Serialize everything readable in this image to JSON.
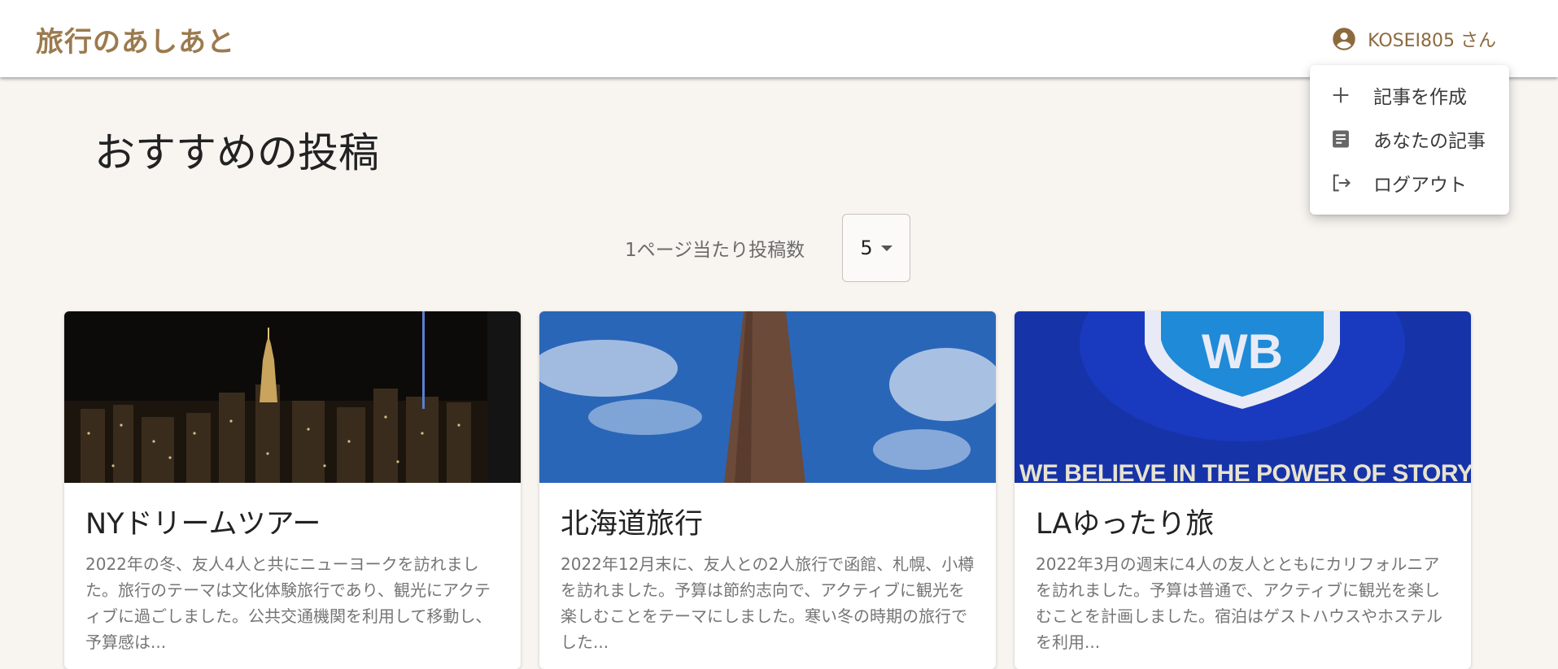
{
  "header": {
    "brand": "旅行のあしあと",
    "user_label": "KOSEI805 さん",
    "user_icon": "account-circle-icon"
  },
  "user_menu": {
    "items": [
      {
        "label": "記事を作成",
        "icon": "plus-icon"
      },
      {
        "label": "あなたの記事",
        "icon": "article-icon"
      },
      {
        "label": "ログアウト",
        "icon": "logout-icon"
      }
    ]
  },
  "main": {
    "title": "おすすめの投稿",
    "per_page_label": "1ページ当たり投稿数",
    "per_page_value": "5"
  },
  "posts": [
    {
      "title": "NYドリームツアー",
      "description": "2022年の冬、友人4人と共にニューヨークを訪れました。旅行のテーマは文化体験旅行であり、観光にアクティブに過ごしました。公共交通機関を利用して移動し、予算感は...",
      "image": "new-york-night-skyline-photo"
    },
    {
      "title": "北海道旅行",
      "description": "2022年12月末に、友人との2人旅行で函館、札幌、小樽を訪れました。予算は節約志向で、アクティブに観光を楽しむことをテーマにしました。寒い冬の時期の旅行でした...",
      "image": "brick-chimney-blue-sky-photo"
    },
    {
      "title": "LAゆったり旅",
      "description": "2022年3月の週末に4人の友人とともにカリフォルニアを訪れました。予算は普通で、アクティブに観光を楽しむことを計画しました。宿泊はゲストハウスやホステルを利用...",
      "image": "warner-bros-shield-photo",
      "image_caption": "WE BELIEVE IN THE POWER OF STORY"
    }
  ],
  "colors": {
    "brand": "#9c7a4e",
    "background": "#f8f5f1",
    "card": "#ffffff"
  }
}
